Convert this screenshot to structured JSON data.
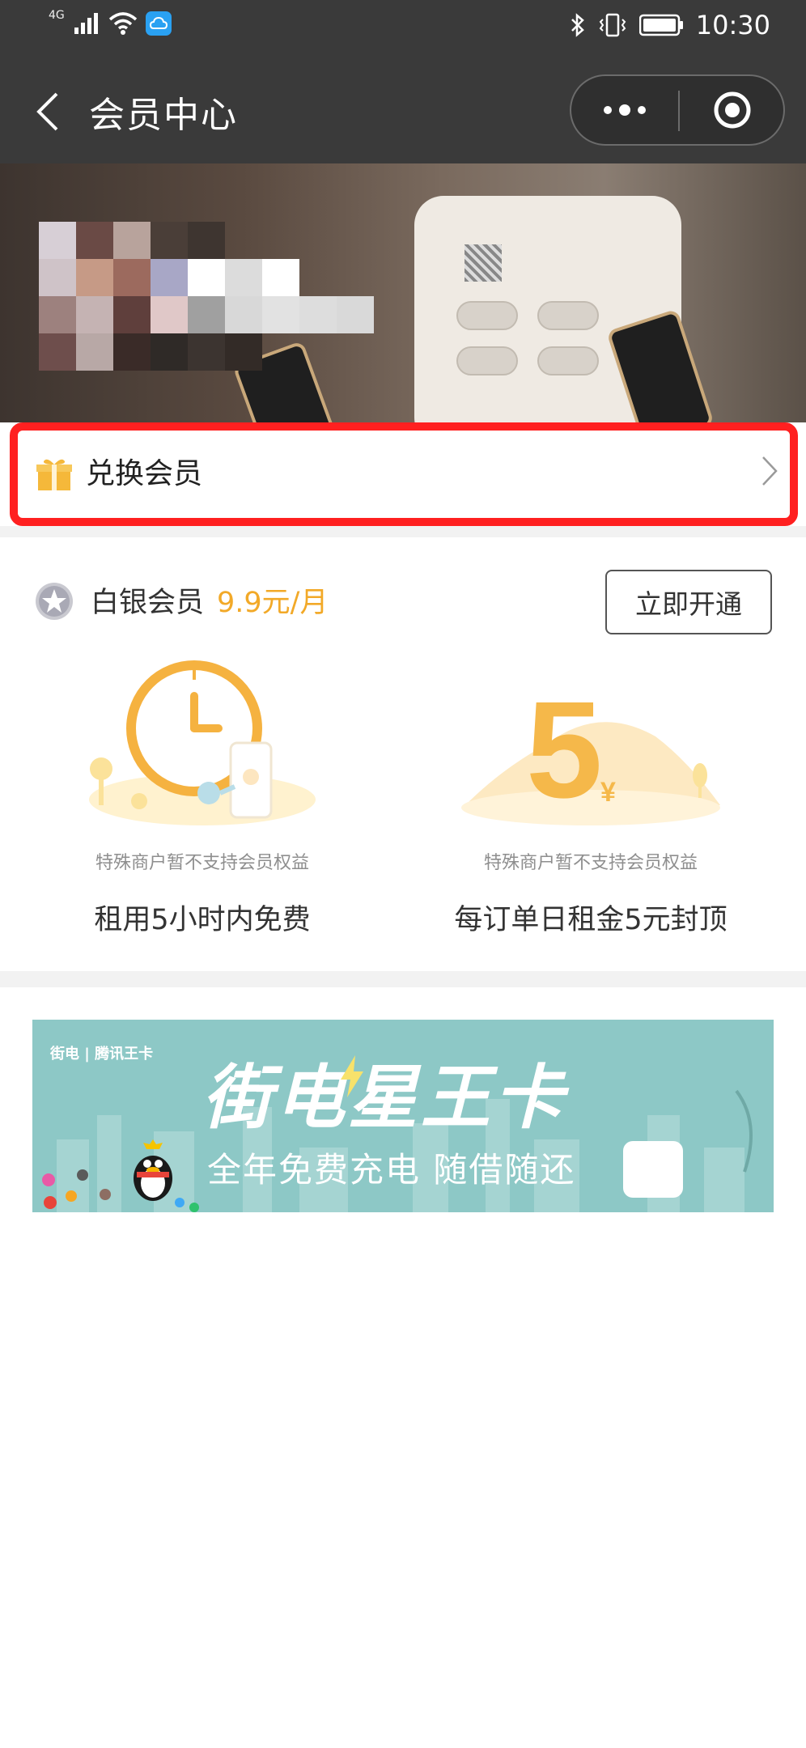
{
  "status_bar": {
    "network": "4G",
    "time": "10:30"
  },
  "nav": {
    "title": "会员中心"
  },
  "exchange": {
    "label": "兑换会员"
  },
  "membership": {
    "tier": "白银会员",
    "price": "9.9元/月",
    "open_button": "立即开通",
    "benefits": [
      {
        "note": "特殊商户暂不支持会员权益",
        "title": "租用5小时内免费"
      },
      {
        "note": "特殊商户暂不支持会员权益",
        "title": "每订单日租金5元封顶"
      }
    ]
  },
  "banner": {
    "logo_text": "街电 | 腾讯王卡",
    "title": "街电星王卡",
    "subtitle": "全年免费充电  随借随还"
  },
  "colors": {
    "accent": "#f2a928",
    "highlight_border": "#ff2020",
    "header_bg": "#3a3a3a",
    "banner_bg": "#8dc8c6"
  }
}
